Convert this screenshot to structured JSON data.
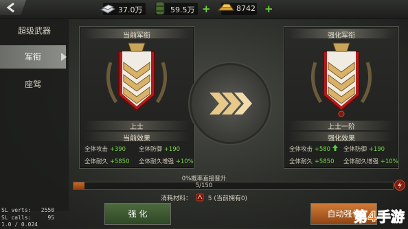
{
  "resources": {
    "silver": {
      "value": "37.0万",
      "icon": "silver-ingot-icon"
    },
    "fuel": {
      "value": "59.5万",
      "icon": "fuel-barrel-icon"
    },
    "gold": {
      "value": "8742",
      "icon": "gold-bar-icon"
    },
    "plus": "+"
  },
  "sidebar": {
    "title": "超级武器",
    "items": [
      {
        "label": "军衔",
        "active": true
      },
      {
        "label": "座驾",
        "active": false
      }
    ]
  },
  "current_rank": {
    "header": "当前军衔",
    "name": "上士",
    "effects_title": "当前效果",
    "stats": [
      {
        "label": "全体攻击",
        "value": "+390"
      },
      {
        "label": "全体防御",
        "value": "+190"
      },
      {
        "label": "全体耐久",
        "value": "+5850"
      },
      {
        "label": "全体耐久增强",
        "value": "+10%"
      }
    ]
  },
  "next_rank": {
    "header": "强化军衔",
    "name": "上士一阶",
    "effects_title": "强化效果",
    "stats": [
      {
        "label": "全体攻击",
        "value": "+580"
      },
      {
        "label": "全体防御",
        "value": "+190"
      },
      {
        "label": "全体耐久",
        "value": "+5850"
      },
      {
        "label": "全体耐久增强",
        "value": "+10%"
      }
    ]
  },
  "progress": {
    "chance_text": "0%概率直接晋升",
    "text": "5/150",
    "current": 5,
    "max": 150
  },
  "material": {
    "label": "消耗材料：",
    "count": "5",
    "owned": "(当前拥有0)"
  },
  "buttons": {
    "upgrade": "强 化",
    "auto_upgrade": "自动强化"
  },
  "debug": {
    "line1": "SL verts:   2550",
    "line2": "SL calls:     95",
    "line3": "1.0 / 0.024"
  },
  "watermark": "第4手游",
  "colors": {
    "accent_green": "#6fd23a",
    "progress": "#c86a2b",
    "button_orange": "#d07b37",
    "button_green": "#4c6a3e"
  }
}
